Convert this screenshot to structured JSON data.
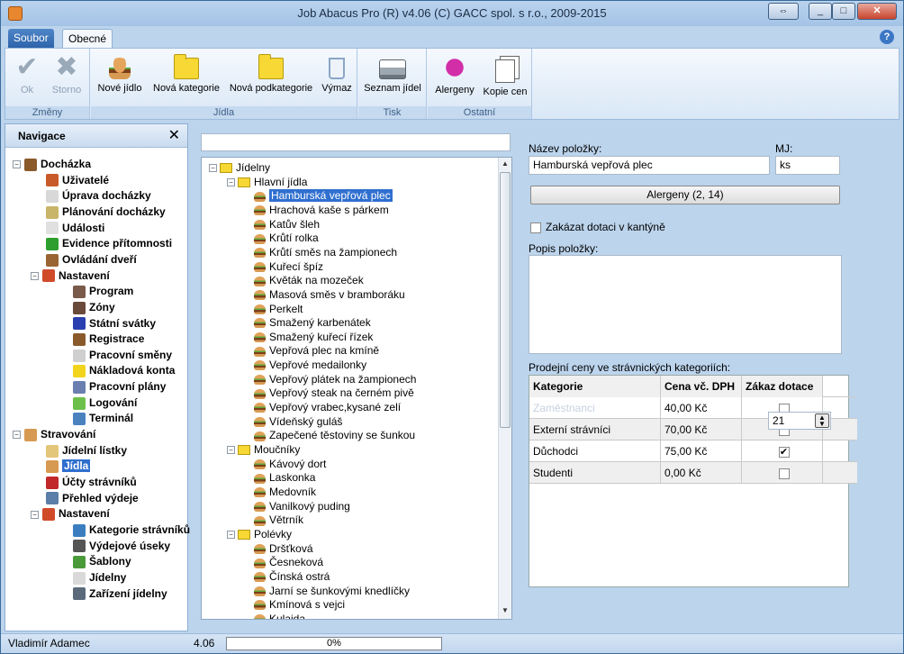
{
  "window": {
    "title": "Job Abacus Pro (R) v4.06 (C) GACC spol. s r.o., 2009-2015"
  },
  "tabs": {
    "file": "Soubor",
    "active": "Obecné"
  },
  "help_label": "?",
  "ribbon": {
    "groups": [
      {
        "label": "Změny",
        "buttons": [
          "Ok",
          "Storno"
        ]
      },
      {
        "label": "Jídla",
        "buttons": [
          "Nové jídlo",
          "Nová kategorie",
          "Nová podkategorie",
          "Výmaz"
        ]
      },
      {
        "label": "Tisk",
        "buttons": [
          "Seznam jídel"
        ]
      },
      {
        "label": "Ostatní",
        "buttons": [
          "Alergeny",
          "Kopie cen"
        ]
      }
    ]
  },
  "nav": {
    "title": "Navigace",
    "close": "✕",
    "items": [
      {
        "label": "Docházka",
        "level": 0,
        "exp": "−",
        "icon": "#8a5a2b"
      },
      {
        "label": "Uživatelé",
        "level": 1,
        "icon": "#c85a2a"
      },
      {
        "label": "Úprava docházky",
        "level": 1,
        "icon": "#d8d8d8"
      },
      {
        "label": "Plánování docházky",
        "level": 1,
        "icon": "#c9b56a"
      },
      {
        "label": "Události",
        "level": 1,
        "icon": "#e0e0e0"
      },
      {
        "label": "Evidence přítomnosti",
        "level": 1,
        "icon": "#2e9e2e"
      },
      {
        "label": "Ovládání dveří",
        "level": 1,
        "icon": "#9a6432"
      },
      {
        "label": "Nastavení",
        "level": 1,
        "exp": "−",
        "icon": "#d04a2a"
      },
      {
        "label": "Program",
        "level": 2,
        "icon": "#7a5a4a"
      },
      {
        "label": "Zóny",
        "level": 2,
        "icon": "#6a4a3a"
      },
      {
        "label": "Státní svátky",
        "level": 2,
        "icon": "#2a3fb0"
      },
      {
        "label": "Registrace",
        "level": 2,
        "icon": "#8a5a2b"
      },
      {
        "label": "Pracovní směny",
        "level": 2,
        "icon": "#cfcfcf"
      },
      {
        "label": "Nákladová konta",
        "level": 2,
        "icon": "#f2d41c"
      },
      {
        "label": "Pracovní plány",
        "level": 2,
        "icon": "#6a7fb0"
      },
      {
        "label": "Logování",
        "level": 2,
        "icon": "#6cc04a"
      },
      {
        "label": "Terminál",
        "level": 2,
        "icon": "#4a82c0"
      },
      {
        "label": "Stravování",
        "level": 0,
        "exp": "−",
        "icon": "#d79a52"
      },
      {
        "label": "Jídelní lístky",
        "level": 1,
        "icon": "#e4c67a"
      },
      {
        "label": "Jídla",
        "level": 1,
        "icon": "#d79a52",
        "selected": true
      },
      {
        "label": "Účty strávníků",
        "level": 1,
        "icon": "#c0282a"
      },
      {
        "label": "Přehled výdeje",
        "level": 1,
        "icon": "#5a7ea8"
      },
      {
        "label": "Nastavení",
        "level": 1,
        "exp": "−",
        "icon": "#d04a2a"
      },
      {
        "label": "Kategorie strávníků",
        "level": 2,
        "icon": "#3a7ec0"
      },
      {
        "label": "Výdejové úseky",
        "level": 2,
        "icon": "#555555"
      },
      {
        "label": "Šablony",
        "level": 2,
        "icon": "#4a9a3a"
      },
      {
        "label": "Jídelny",
        "level": 2,
        "icon": "#d9d9d9"
      },
      {
        "label": "Zařízení jídelny",
        "level": 2,
        "icon": "#5a6a7a"
      }
    ]
  },
  "tree": {
    "search_value": "",
    "items": [
      {
        "label": "Jídelny",
        "level": 0,
        "type": "folder",
        "exp": "−"
      },
      {
        "label": "Hlavní jídla",
        "level": 1,
        "type": "folder",
        "exp": "−"
      },
      {
        "label": "Hamburská vepřová plec",
        "level": 2,
        "type": "food",
        "selected": true
      },
      {
        "label": "Hrachová kaše s párkem",
        "level": 2,
        "type": "food"
      },
      {
        "label": "Katův šleh",
        "level": 2,
        "type": "food"
      },
      {
        "label": "Krůtí rolka",
        "level": 2,
        "type": "food"
      },
      {
        "label": "Krůtí směs na žampionech",
        "level": 2,
        "type": "food"
      },
      {
        "label": "Kuřecí špíz",
        "level": 2,
        "type": "food"
      },
      {
        "label": "Květák na mozeček",
        "level": 2,
        "type": "food"
      },
      {
        "label": "Masová směs v bramboráku",
        "level": 2,
        "type": "food"
      },
      {
        "label": "Perkelt",
        "level": 2,
        "type": "food"
      },
      {
        "label": "Smažený karbenátek",
        "level": 2,
        "type": "food"
      },
      {
        "label": "Smažený kuřecí řízek",
        "level": 2,
        "type": "food"
      },
      {
        "label": "Vepřová plec na kmíně",
        "level": 2,
        "type": "food"
      },
      {
        "label": "Vepřové medailonky",
        "level": 2,
        "type": "food"
      },
      {
        "label": "Vepřový plátek na žampionech",
        "level": 2,
        "type": "food"
      },
      {
        "label": "Vepřový steak na černém pivě",
        "level": 2,
        "type": "food"
      },
      {
        "label": "Vepřový vrabec,kysané zelí",
        "level": 2,
        "type": "food"
      },
      {
        "label": "Vídeňský guláš",
        "level": 2,
        "type": "food"
      },
      {
        "label": "Zapečené těstoviny se šunkou",
        "level": 2,
        "type": "food"
      },
      {
        "label": "Moučníky",
        "level": 1,
        "type": "folder",
        "exp": "−"
      },
      {
        "label": "Kávový dort",
        "level": 2,
        "type": "food"
      },
      {
        "label": "Laskonka",
        "level": 2,
        "type": "food"
      },
      {
        "label": "Medovník",
        "level": 2,
        "type": "food"
      },
      {
        "label": "Vanilkový puding",
        "level": 2,
        "type": "food"
      },
      {
        "label": "Větrník",
        "level": 2,
        "type": "food"
      },
      {
        "label": "Polévky",
        "level": 1,
        "type": "folder",
        "exp": "−"
      },
      {
        "label": "Dršťková",
        "level": 2,
        "type": "food"
      },
      {
        "label": "Česneková",
        "level": 2,
        "type": "food"
      },
      {
        "label": "Čínská ostrá",
        "level": 2,
        "type": "food"
      },
      {
        "label": "Jarní se šunkovými knedlíčky",
        "level": 2,
        "type": "food"
      },
      {
        "label": "Kmínová s vejci",
        "level": 2,
        "type": "food"
      },
      {
        "label": "Kulajda",
        "level": 2,
        "type": "food"
      }
    ]
  },
  "detail": {
    "name_label": "Název položky:",
    "name_value": "Hamburská vepřová plec",
    "unit_label": "MJ:",
    "unit_value": "ks",
    "allergens_button": "Alergeny (2, 14)",
    "subsidy_checkbox": "Zakázat dotaci v kantýně",
    "description_label": "Popis položky:",
    "description_value": "",
    "prices_label": "Prodejní ceny ve strávnických kategoriích:",
    "grid": {
      "headers": [
        "Kategorie",
        "Cena vč. DPH",
        "Zákaz dotace"
      ],
      "rows": [
        {
          "category": "Zaměstnanci",
          "price": "40,00 Kč",
          "checked": false
        },
        {
          "category": "Externí strávníci",
          "price": "70,00 Kč",
          "checked": false
        },
        {
          "category": "Důchodci",
          "price": "75,00 Kč",
          "checked": true
        },
        {
          "category": "Studenti",
          "price": "0,00 Kč",
          "checked": false
        }
      ]
    },
    "spin_value": "21"
  },
  "status": {
    "user": "Vladimír Adamec",
    "version": "4.06",
    "progress_text": "0%",
    "progress": 0
  },
  "colors": {
    "selection": "#2f6fcf",
    "frame": "#bcd4ec"
  }
}
